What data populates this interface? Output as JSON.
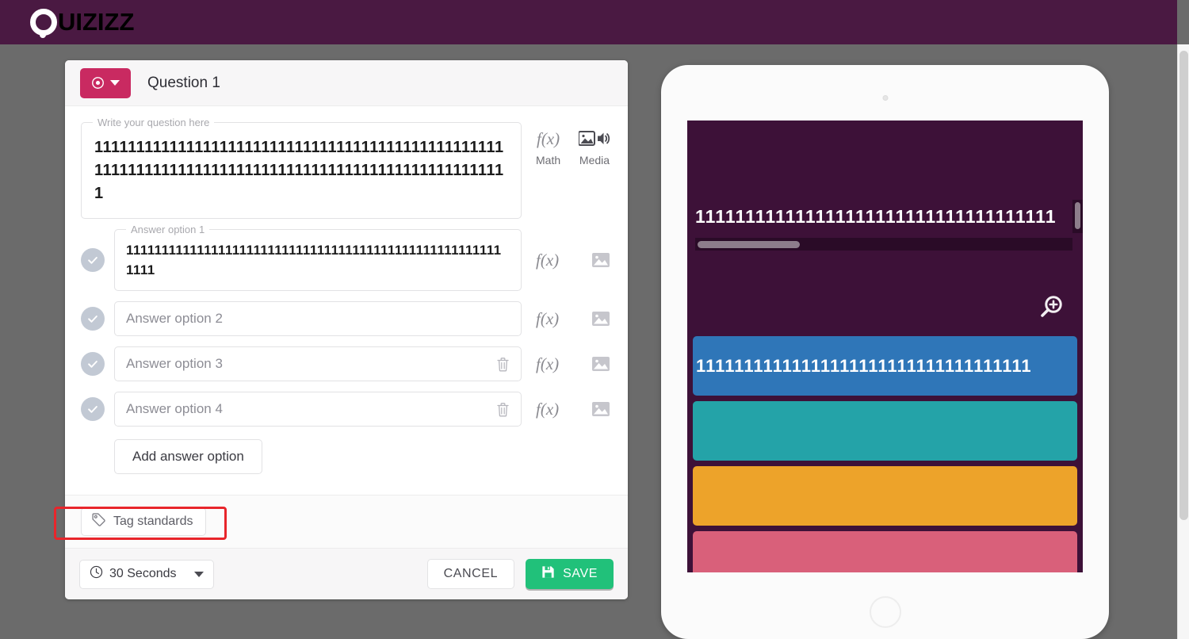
{
  "brand": {
    "logo_q": "Q",
    "logo_rest": "UIZIZZ",
    "bar_color": "#4a1942"
  },
  "editor": {
    "question_number_label": "Question 1",
    "question_type_icon": "radio-button-icon",
    "question_type_color": "#c92a61",
    "question_field": {
      "legend": "Write your question here",
      "value": "111111111111111111111111111111111111111111111111111111111111111111111111111111111111111111111111111"
    },
    "tools": {
      "math_label": "Math",
      "math_icon": "fx-icon",
      "media_label": "Media",
      "media_icon": "image-audio-icon"
    },
    "answers": [
      {
        "legend": "Answer option 1",
        "value": "111111111111111111111111111111111111111111111111111111111",
        "placeholder": "",
        "filled": true,
        "deletable": false,
        "correct": false
      },
      {
        "legend": "",
        "value": "",
        "placeholder": "Answer option 2",
        "filled": false,
        "deletable": false,
        "correct": false
      },
      {
        "legend": "",
        "value": "",
        "placeholder": "Answer option 3",
        "filled": false,
        "deletable": true,
        "correct": false
      },
      {
        "legend": "",
        "value": "",
        "placeholder": "Answer option 4",
        "filled": false,
        "deletable": true,
        "correct": false
      }
    ],
    "add_answer_label": "Add answer option",
    "tag_standards_label": "Tag standards",
    "tag_standards_icon": "tag-icon",
    "timer_label": "30 Seconds",
    "timer_icon": "clock-icon",
    "cancel_label": "CANCEL",
    "save_label": "SAVE",
    "save_icon": "floppy-disk-icon",
    "save_color": "#21c17a",
    "annotation_color": "#e8252b"
  },
  "preview": {
    "screen_bg": "#3d1138",
    "question_text": "111111111111111111111111111111111111",
    "zoom_icon": "zoom-in-icon",
    "hscroll_percent": 27,
    "tiles": [
      {
        "color": "#2f76b8",
        "text": "11111111111111111111111111111111111"
      },
      {
        "color": "#24a3a8",
        "text": ""
      },
      {
        "color": "#eda32a",
        "text": ""
      },
      {
        "color": "#d9607a",
        "text": ""
      }
    ]
  }
}
